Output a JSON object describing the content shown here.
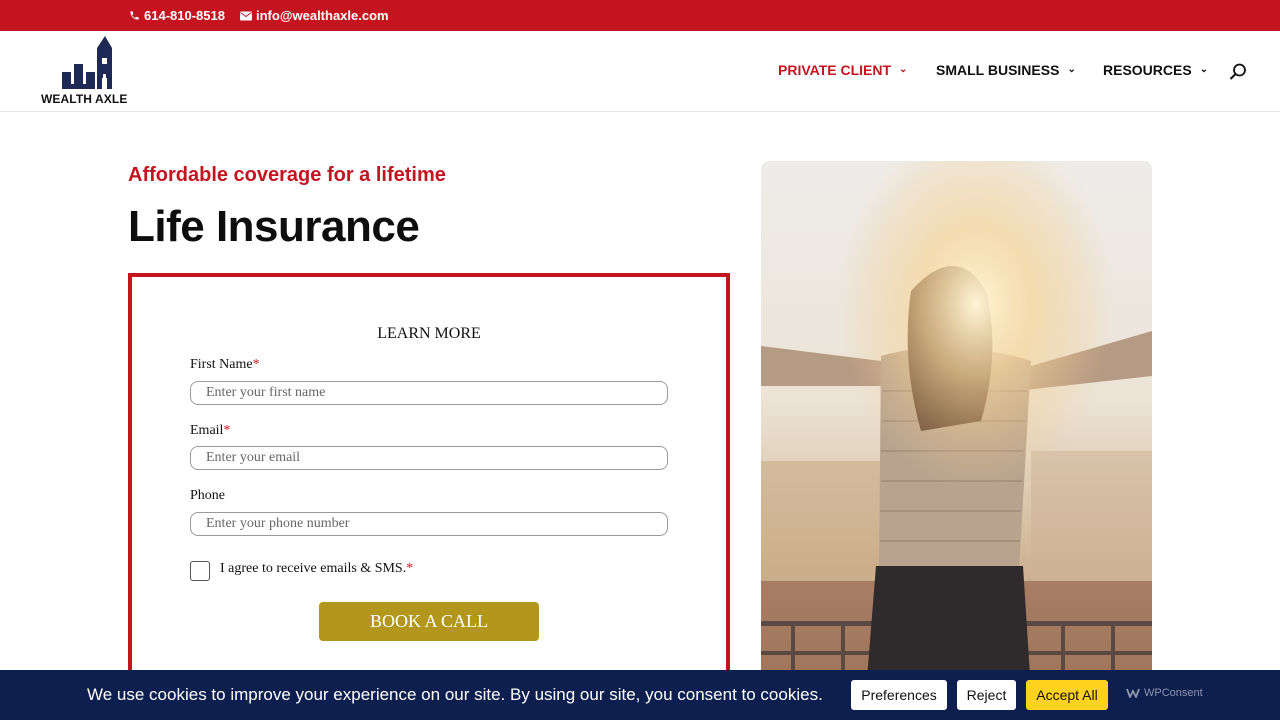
{
  "topbar": {
    "phone": "614-810-8518",
    "email": "info@wealthaxle.com"
  },
  "header": {
    "logo_text": "WEALTH AXLE",
    "nav": [
      {
        "label": "PRIVATE CLIENT",
        "icon": "chevron-down-icon"
      },
      {
        "label": "SMALL BUSINESS",
        "icon": "chevron-down-icon"
      },
      {
        "label": "RESOURCES",
        "icon": "chevron-down-icon"
      }
    ],
    "search_icon": "search-icon"
  },
  "hero": {
    "tagline": "Affordable coverage for a lifetime",
    "title": "Life Insurance"
  },
  "form": {
    "heading": "LEARN MORE",
    "first_name_label": "First Name",
    "first_name_placeholder": "Enter your first name",
    "email_label": "Email",
    "email_placeholder": "Enter your email",
    "phone_label": "Phone",
    "phone_placeholder": "Enter your phone number",
    "consent_label": "I agree to receive emails & SMS.",
    "required_mark": "*",
    "submit_label": "BOOK A CALL"
  },
  "cookie": {
    "message": "We use cookies to improve your experience on our site. By using our site, you consent to cookies.",
    "preferences_label": "Preferences",
    "reject_label": "Reject",
    "accept_label": "Accept All",
    "brand": "WPConsent"
  },
  "colors": {
    "brand_red": "#c4141f",
    "navy": "#0d1f4f",
    "gold_button": "#b3961c",
    "accept_yellow": "#ffd21f"
  }
}
